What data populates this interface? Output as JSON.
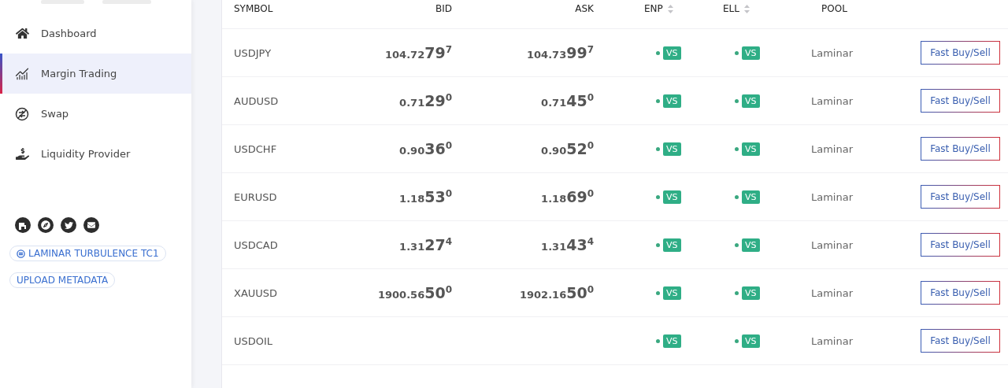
{
  "sidebar": {
    "items": [
      {
        "kind": "home",
        "label": "Dashboard",
        "selected": false
      },
      {
        "kind": "chart",
        "label": "Margin Trading",
        "selected": true
      },
      {
        "kind": "swap",
        "label": "Swap",
        "selected": false
      },
      {
        "kind": "provider",
        "label": "Liquidity Provider",
        "selected": false
      }
    ],
    "links": [
      {
        "label": "LAMINAR TURBULENCE TC1",
        "icon": true
      },
      {
        "label": "UPLOAD METADATA",
        "icon": false
      }
    ]
  },
  "table": {
    "columns": [
      {
        "label": "SYMBOL",
        "sortable": false
      },
      {
        "label": "BID",
        "sortable": false
      },
      {
        "label": "ASK",
        "sortable": false
      },
      {
        "label": "ENP",
        "sortable": true
      },
      {
        "label": "ELL",
        "sortable": true
      },
      {
        "label": "POOL",
        "sortable": false
      }
    ],
    "rows": [
      {
        "symbol": "USDJPY",
        "bid": {
          "lead": "104.72",
          "big": "79",
          "pip": "7"
        },
        "ask": {
          "lead": "104.73",
          "big": "99",
          "pip": "7"
        },
        "enp": "VS",
        "ell": "VS",
        "pool": "Laminar",
        "action": "Fast Buy/Sell"
      },
      {
        "symbol": "AUDUSD",
        "bid": {
          "lead": "0.71",
          "big": "29",
          "pip": "0"
        },
        "ask": {
          "lead": "0.71",
          "big": "45",
          "pip": "0"
        },
        "enp": "VS",
        "ell": "VS",
        "pool": "Laminar",
        "action": "Fast Buy/Sell"
      },
      {
        "symbol": "USDCHF",
        "bid": {
          "lead": "0.90",
          "big": "36",
          "pip": "0"
        },
        "ask": {
          "lead": "0.90",
          "big": "52",
          "pip": "0"
        },
        "enp": "VS",
        "ell": "VS",
        "pool": "Laminar",
        "action": "Fast Buy/Sell"
      },
      {
        "symbol": "EURUSD",
        "bid": {
          "lead": "1.18",
          "big": "53",
          "pip": "0"
        },
        "ask": {
          "lead": "1.18",
          "big": "69",
          "pip": "0"
        },
        "enp": "VS",
        "ell": "VS",
        "pool": "Laminar",
        "action": "Fast Buy/Sell"
      },
      {
        "symbol": "USDCAD",
        "bid": {
          "lead": "1.31",
          "big": "27",
          "pip": "4"
        },
        "ask": {
          "lead": "1.31",
          "big": "43",
          "pip": "4"
        },
        "enp": "VS",
        "ell": "VS",
        "pool": "Laminar",
        "action": "Fast Buy/Sell"
      },
      {
        "symbol": "XAUUSD",
        "bid": {
          "lead": "1900.56",
          "big": "50",
          "pip": "0"
        },
        "ask": {
          "lead": "1902.16",
          "big": "50",
          "pip": "0"
        },
        "enp": "VS",
        "ell": "VS",
        "pool": "Laminar",
        "action": "Fast Buy/Sell"
      },
      {
        "symbol": "USDOIL",
        "enp": "VS",
        "ell": "VS",
        "pool": "Laminar",
        "action": "Fast Buy/Sell"
      }
    ]
  }
}
